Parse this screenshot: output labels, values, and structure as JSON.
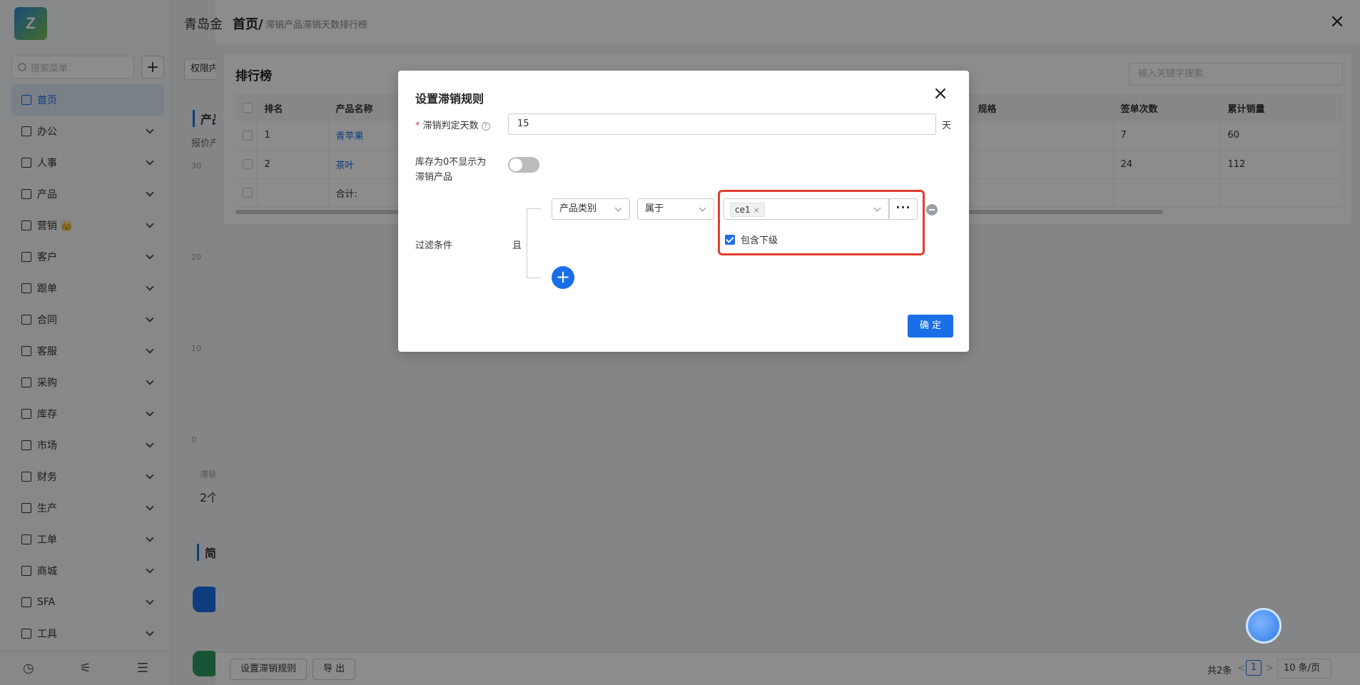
{
  "app": {
    "brand": "青岛金",
    "logo_text": "Z"
  },
  "sidebar": {
    "search_placeholder": "搜索菜单",
    "add_label": "+",
    "items": [
      {
        "label": "首页",
        "active": true
      },
      {
        "label": "办公"
      },
      {
        "label": "人事"
      },
      {
        "label": "产品"
      },
      {
        "label": "营销 👑"
      },
      {
        "label": "客户"
      },
      {
        "label": "跟单"
      },
      {
        "label": "合同"
      },
      {
        "label": "客服"
      },
      {
        "label": "采购"
      },
      {
        "label": "库存"
      },
      {
        "label": "市场"
      },
      {
        "label": "财务"
      },
      {
        "label": "生产"
      },
      {
        "label": "工单"
      },
      {
        "label": "商城"
      },
      {
        "label": "SFA"
      },
      {
        "label": "工具"
      }
    ],
    "footer_icons": [
      "history-icon",
      "sliders-icon",
      "collapse-icon"
    ]
  },
  "background": {
    "perm_label": "权限内",
    "card_title": "产品",
    "sub_text": "报价产",
    "y_ticks": [
      "30",
      "20",
      "10",
      "0"
    ],
    "foot1": "滞销",
    "foot2": "2个",
    "card_title2": "简"
  },
  "drawer": {
    "crumb_main": "首页/",
    "crumb_sub": "滞销产品滞销天数排行榜",
    "panel_title": "排行榜",
    "search_placeholder": "输入关键字搜索",
    "columns": [
      "排名",
      "产品名称",
      "规格",
      "签单次数",
      "累计销量"
    ],
    "rows": [
      {
        "rank": "1",
        "name": "青苹果",
        "spec": "",
        "count": "7",
        "sales": "60"
      },
      {
        "rank": "2",
        "name": "茶叶",
        "spec": "",
        "count": "24",
        "sales": "112"
      }
    ],
    "total_label": "合计:",
    "buttons": {
      "set_rule": "设置滞销规则",
      "export": "导 出"
    },
    "pager": {
      "total": "共2条",
      "current": "1",
      "size": "10 条/页",
      "prev": "<",
      "next": ">"
    }
  },
  "modal": {
    "title": "设置滞销规则",
    "days_label": "滞销判定天数",
    "days_value": "15",
    "days_unit": "天",
    "zero_stock_label_1": "库存为0不显示为",
    "zero_stock_label_2": "滞销产品",
    "filter_label": "过滤条件",
    "and_label": "且",
    "field_select": "产品类别",
    "op_select": "属于",
    "tag_value": "ce1",
    "more_label": "···",
    "include_sub_label": "包含下级",
    "ok_label": "确 定"
  }
}
